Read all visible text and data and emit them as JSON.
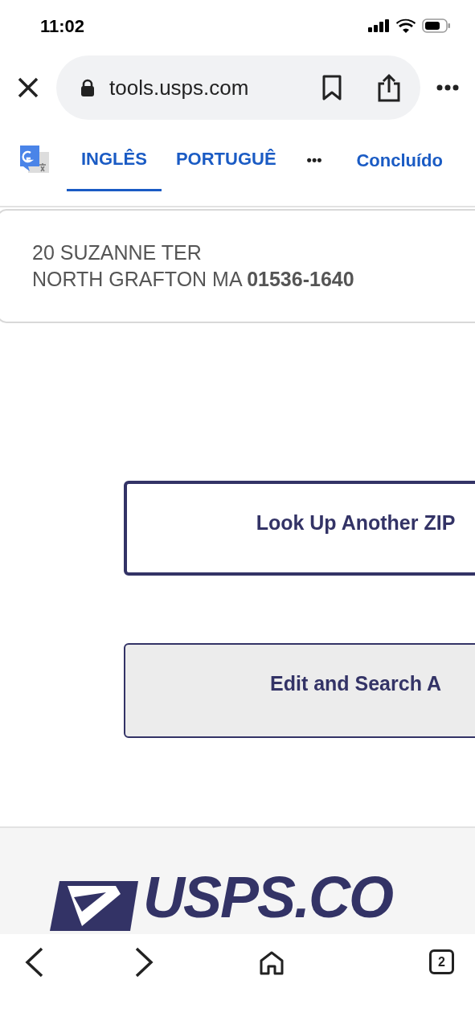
{
  "status_bar": {
    "time": "11:02"
  },
  "browser": {
    "url": "tools.usps.com"
  },
  "translate_bar": {
    "tabs": [
      {
        "label": "INGLÊS",
        "selected": true
      },
      {
        "label": "PORTUGUÊ",
        "selected": false
      }
    ],
    "more": "•••",
    "done": "Concluído"
  },
  "address": {
    "lines": [
      "20 SUZANNE TER",
      "NORTH GRAFTON MA **01536-1640**"
    ]
  },
  "buttons": [
    {
      "label": "Look Up Another ZIP",
      "kind": "outline"
    },
    {
      "label": "Edit and Search A",
      "kind": "filled"
    }
  ],
  "footer": {
    "logo": "USPS.CO"
  },
  "toolbar": {
    "tab_count": "2"
  }
}
